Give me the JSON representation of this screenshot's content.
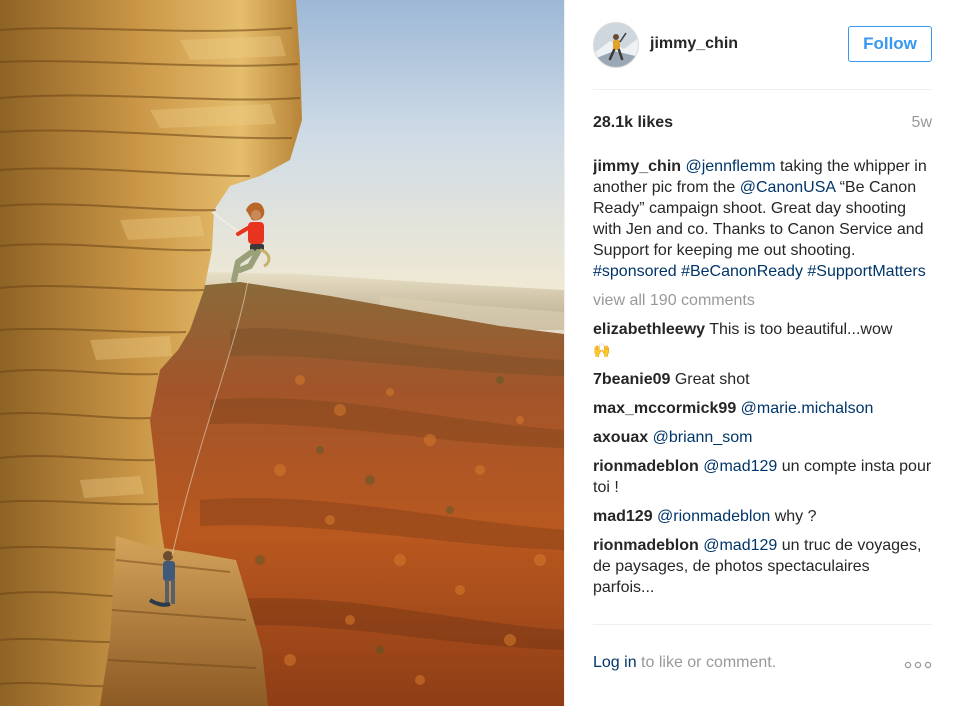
{
  "post": {
    "username": "jimmy_chin",
    "follow_label": "Follow",
    "likes": "28.1k likes",
    "time_ago": "5w",
    "caption": {
      "author": "jimmy_chin",
      "mention_1": "@jennflemm",
      "text_1": " taking the whipper in another pic from the ",
      "mention_2": "@CanonUSA",
      "text_2": " “Be Canon Ready” campaign shoot. Great day shooting with Jen and co. Thanks to Canon Service and Support for keeping me out shooting. ",
      "tag_1": "#sponsored",
      "tag_2": "#BeCanonReady",
      "tag_3": "#SupportMatters"
    },
    "view_all_comments": "view all 190 comments",
    "comments": [
      {
        "author": "elizabethleewy",
        "text": "This is too beautiful...wow",
        "emoji": "🙌"
      },
      {
        "author": "7beanie09",
        "text": "Great shot"
      },
      {
        "author": "max_mccormick99",
        "mention": "@marie.michalson"
      },
      {
        "author": "axouax",
        "mention": "@briann_som"
      },
      {
        "author": "rionmadeblon",
        "mention": "@mad129",
        "text": "un compte insta pour toi !"
      },
      {
        "author": "mad129",
        "mention": "@rionmadeblon",
        "text": "why ?"
      },
      {
        "author": "rionmadeblon",
        "mention": "@mad129",
        "text": "un truc de voyages, de paysages, de photos spectaculaires parfois..."
      }
    ],
    "login_link": "Log in",
    "login_suffix": " to like or comment."
  },
  "icons": {
    "avatar": "climber-avatar",
    "more": "more-options-icon"
  },
  "colors": {
    "link_blue": "#003569",
    "follow_blue": "#3897f0",
    "muted_gray": "#999999",
    "text": "#262626"
  }
}
